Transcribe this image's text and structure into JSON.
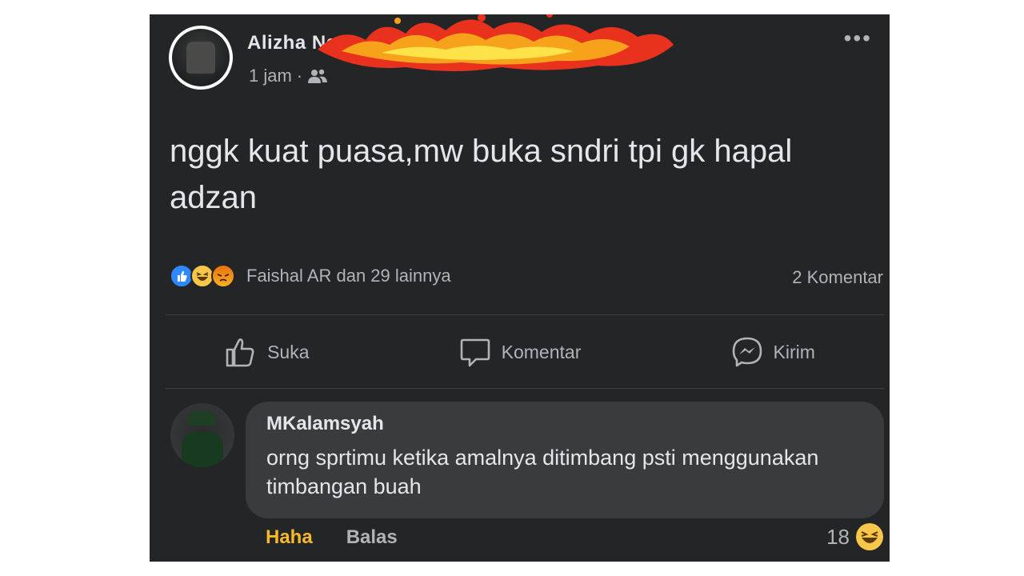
{
  "post": {
    "author_name": "Alizha Na...",
    "time": "1 jam",
    "separator": "·",
    "privacy_icon": "friends-icon",
    "more_label": "•••",
    "content": "nggk kuat puasa,mw buka sndri tpi gk hapal adzan",
    "reactions_icons": [
      "like-icon",
      "haha-icon",
      "angry-icon"
    ],
    "reactions_text": "Faishal AR dan 29 lainnya",
    "comments_count": "2 Komentar"
  },
  "actions": {
    "like_label": "Suka",
    "comment_label": "Komentar",
    "send_label": "Kirim"
  },
  "comment": {
    "author": "MKalamsyah",
    "text": "orng sprtimu ketika amalnya ditimbang psti menggunakan timbangan buah",
    "reaction_label": "Haha",
    "reply_label": "Balas",
    "reaction_count": "18",
    "reaction_icon": "haha-icon"
  },
  "colors": {
    "card_bg": "#242526",
    "bubble_bg": "#3a3b3c",
    "text_primary": "#e4e6eb",
    "text_secondary": "#b0b3b8",
    "haha_accent": "#f7b928",
    "like_blue": "#2e89ff"
  }
}
